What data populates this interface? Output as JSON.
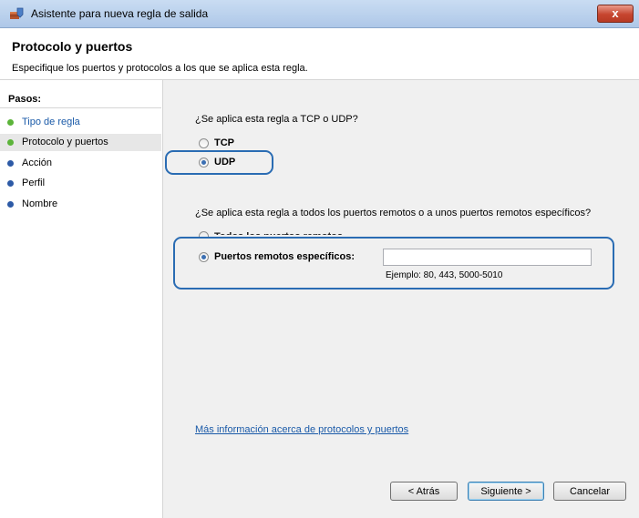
{
  "window": {
    "title": "Asistente para nueva regla de salida",
    "close_label": "x"
  },
  "header": {
    "title": "Protocolo y puertos",
    "description": "Especifique los puertos y protocolos a los que se aplica esta regla."
  },
  "steps": {
    "title": "Pasos:",
    "items": [
      {
        "label": "Tipo de regla",
        "state": "done"
      },
      {
        "label": "Protocolo y puertos",
        "state": "current"
      },
      {
        "label": "Acción",
        "state": "pending"
      },
      {
        "label": "Perfil",
        "state": "pending"
      },
      {
        "label": "Nombre",
        "state": "pending"
      }
    ]
  },
  "protocol": {
    "question": "¿Se aplica esta regla a TCP o UDP?",
    "options": [
      {
        "label": "TCP",
        "selected": false
      },
      {
        "label": "UDP",
        "selected": true
      }
    ]
  },
  "ports": {
    "question": "¿Se aplica esta regla a todos los puertos remotos o a unos puertos remotos específicos?",
    "all_ports_label": "Todos los puertos remotos",
    "specific_label": "Puertos remotos específicos:",
    "specific_value": "",
    "example": "Ejemplo: 80, 443, 5000-5010"
  },
  "link": {
    "label": "Más información acerca de protocolos y puertos"
  },
  "buttons": {
    "back": "< Atrás",
    "next": "Siguiente >",
    "cancel": "Cancelar"
  },
  "colors": {
    "highlight": "#2a6cb3",
    "link": "#1a5aa8",
    "step_done": "#5cb43a",
    "step_pending": "#2d5aa6"
  }
}
